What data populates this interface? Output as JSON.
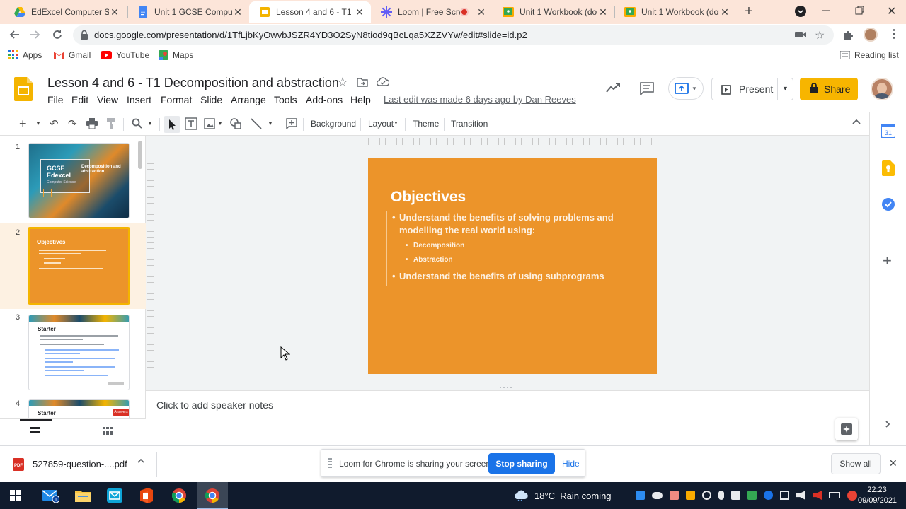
{
  "browser": {
    "tabs": [
      {
        "title": "EdExcel Computer Sci",
        "icon": "google-drive-icon",
        "active": false
      },
      {
        "title": "Unit 1 GCSE Compute",
        "icon": "google-docs-icon",
        "active": false
      },
      {
        "title": "Lesson 4 and 6 - T1 De",
        "icon": "google-slides-icon",
        "active": true
      },
      {
        "title": "Loom | Free Screen",
        "icon": "loom-icon",
        "active": false
      },
      {
        "title": "Unit 1 Workbook (don",
        "icon": "google-classroom-icon",
        "active": false
      },
      {
        "title": "Unit 1 Workbook (don",
        "icon": "google-classroom-icon",
        "active": false
      }
    ],
    "url": "docs.google.com/presentation/d/1TfLjbKyOwvbJSZR4YD3O2SyN8tiod9qBcLqa5XZZVYw/edit#slide=id.p2",
    "bookmarks": [
      "Apps",
      "Gmail",
      "YouTube",
      "Maps"
    ],
    "reading_list": "Reading list"
  },
  "slides_app": {
    "doc_title": "Lesson 4 and 6 - T1 Decomposition and abstraction",
    "menus": [
      "File",
      "Edit",
      "View",
      "Insert",
      "Format",
      "Slide",
      "Arrange",
      "Tools",
      "Add-ons",
      "Help"
    ],
    "last_edit": "Last edit was made 6 days ago by Dan Reeves",
    "present_label": "Present",
    "share_label": "Share",
    "toolbar": {
      "background": "Background",
      "layout": "Layout",
      "theme": "Theme",
      "transition": "Transition"
    }
  },
  "filmstrip": {
    "slides": [
      {
        "number": "1",
        "title": "GCSE Edexcel",
        "subtitle": "Decomposition and abstraction",
        "small": "Computer Science"
      },
      {
        "number": "2",
        "title": "Objectives"
      },
      {
        "number": "3",
        "title": "Starter"
      },
      {
        "number": "4",
        "title": "Starter",
        "badge": "Answers"
      }
    ]
  },
  "current_slide": {
    "title": "Objectives",
    "bullets": [
      "Understand the benefits of solving problems and modelling the real world using:",
      "Understand the benefits of using subprograms"
    ],
    "sub_bullets": [
      "Decomposition",
      "Abstraction"
    ]
  },
  "notes_placeholder": "Click to add speaker notes",
  "download_bar": {
    "file": "527859-question-....pdf",
    "loom_message": "Loom for Chrome is sharing your screen.",
    "stop_sharing": "Stop sharing",
    "hide": "Hide",
    "show_all": "Show all"
  },
  "taskbar": {
    "weather": "18°C  Rain coming",
    "time": "22:23",
    "date": "09/09/2021"
  },
  "colors": {
    "slide_orange": "#ec942a",
    "share_yellow": "#f7b500",
    "tabstrip_bg": "#fce5d9",
    "loom_blue": "#1a73e8"
  }
}
